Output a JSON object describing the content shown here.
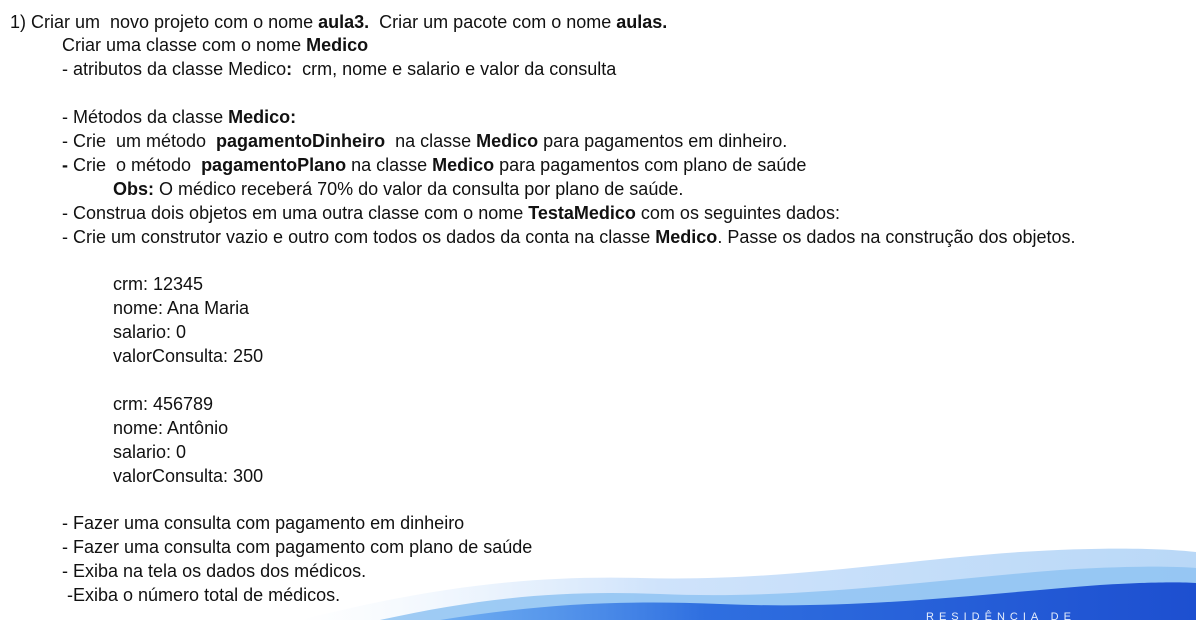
{
  "exercise": {
    "line1": {
      "a": "1) Criar um  novo projeto com o nome ",
      "b": "aula3.",
      "c": "  Criar um pacote com o nome ",
      "d": "aulas."
    },
    "line2": {
      "a": "Criar uma classe com o nome ",
      "b": "Medico"
    },
    "line3": {
      "a": "- atributos da classe Medico",
      "b": ":",
      "c": "  crm, nome e salario e valor da consulta"
    },
    "line4": {
      "a": "- Métodos da classe ",
      "b": "Medico:"
    },
    "line5": {
      "a": "- Crie  um método  ",
      "b": "pagamentoDinheiro",
      "c": "  na classe ",
      "d": "Medico",
      "e": " para pagamentos em dinheiro."
    },
    "line6": {
      "a": "-",
      "b": " Crie  o método  ",
      "c": "pagamentoPlano",
      "d": " na classe ",
      "e": "Medico",
      "f": " para pagamentos com plano de saúde"
    },
    "line7": {
      "a": "Obs:",
      "b": " O médico receberá 70% do valor da consulta por plano de saúde."
    },
    "line8": {
      "a": "- Construa dois objetos em uma outra classe com o nome ",
      "b": "TestaMedico",
      "c": " com os seguintes dados:"
    },
    "line9": {
      "a": "- Crie um construtor vazio e outro com todos os dados da conta na classe ",
      "b": "Medico",
      "c": ". Passe os dados na construção dos objetos."
    }
  },
  "medicos": [
    {
      "crm": "crm: 12345",
      "nome": "nome: Ana Maria",
      "salario": "salario: 0",
      "valor": "valorConsulta: 250"
    },
    {
      "crm": "crm: 456789",
      "nome": "nome: Antônio",
      "salario": "salario: 0",
      "valor": "valorConsulta: 300"
    }
  ],
  "tasks": [
    "- Fazer uma consulta com pagamento em dinheiro",
    "- Fazer uma consulta com pagamento com plano de saúde",
    "- Exiba na tela os dados dos médicos.",
    " -Exiba o número total de médicos."
  ],
  "footer": {
    "brand_text": "RESIDÊNCIA DE",
    "colors": {
      "wave_light": "#cfe3fb",
      "wave_mid": "#8fc3f2",
      "wave_dark": "#2f6fe0",
      "wave_deep": "#1d4fd0"
    }
  }
}
